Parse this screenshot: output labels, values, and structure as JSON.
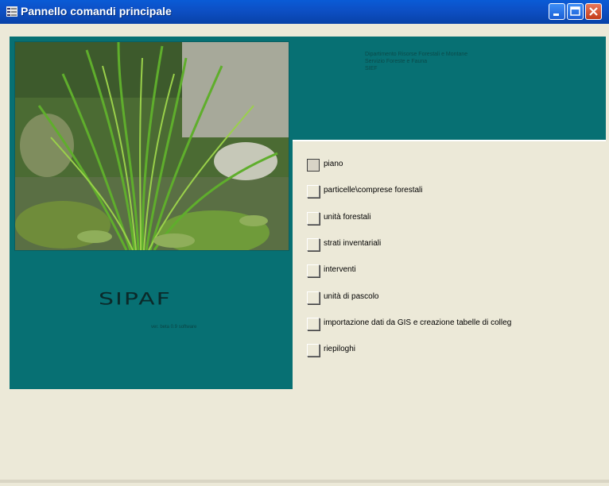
{
  "window": {
    "title": "Pannello comandi principale",
    "titlebar_color": "#0A5BD6",
    "buttons": [
      "minimize",
      "maximize",
      "close"
    ]
  },
  "header": {
    "lines": [
      "Dipartimento Risorse Forestali e Montane",
      "Servizio Foreste e Fauna",
      "SIEF"
    ]
  },
  "brand": {
    "name": "SIPAF",
    "version": "ver. beta 0.9 software"
  },
  "menu": {
    "items": [
      {
        "label": "piano"
      },
      {
        "label": "particelle\\comprese forestali"
      },
      {
        "label": "unità forestali"
      },
      {
        "label": "strati inventariali"
      },
      {
        "label": "interventi"
      },
      {
        "label": "unità di pascolo"
      },
      {
        "label": "importazione dati da GIS e creazione tabelle di colleg"
      },
      {
        "label": "riepiloghi"
      }
    ]
  },
  "colors": {
    "teal": "#077073",
    "face": "#ECE9D8"
  },
  "image": {
    "subject": "grass-plant-photo"
  }
}
